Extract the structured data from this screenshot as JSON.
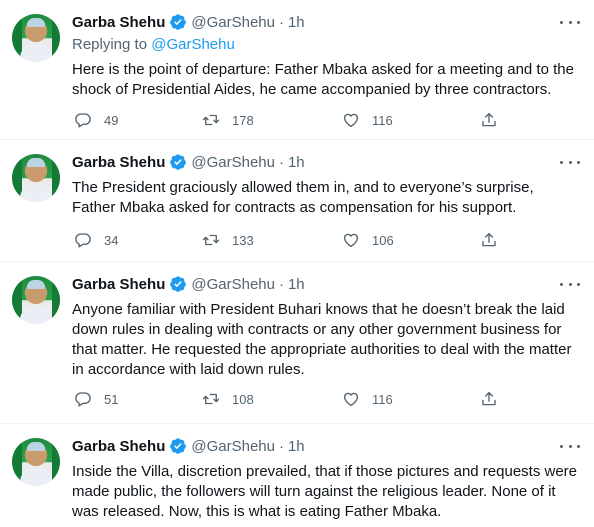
{
  "tweets": [
    {
      "author": "Garba Shehu",
      "handle": "@GarShehu",
      "separator": "·",
      "time": "1h",
      "replying_label": "Replying to",
      "replying_to": "@GarShehu",
      "text": "Here is the point of departure: Father Mbaka asked for a meeting and to the shock of Presidential Aides, he came accompanied by three contractors.",
      "replies": "49",
      "retweets": "178",
      "likes": "116"
    },
    {
      "author": "Garba Shehu",
      "handle": "@GarShehu",
      "separator": "·",
      "time": "1h",
      "text": "The President graciously allowed them in, and to everyone’s surprise, Father Mbaka asked for contracts as compensation for his support.",
      "replies": "34",
      "retweets": "133",
      "likes": "106"
    },
    {
      "author": "Garba Shehu",
      "handle": "@GarShehu",
      "separator": "·",
      "time": "1h",
      "text": "Anyone familiar with President Buhari knows that he doesn’t break the laid down rules in dealing with contracts or any other government business for that matter. He requested the appropriate authorities to deal with the matter in accordance with laid down rules.",
      "replies": "51",
      "retweets": "108",
      "likes": "116"
    },
    {
      "author": "Garba Shehu",
      "handle": "@GarShehu",
      "separator": "·",
      "time": "1h",
      "text": "Inside the Villa, discretion prevailed, that if those pictures and requests were made public, the followers will turn against the religious leader. None of it was released. Now, this is what is eating Father Mbaka."
    }
  ],
  "colors": {
    "accent": "#1d9bf0",
    "secondary_text": "#536471",
    "primary_text": "#0f1419"
  },
  "icons": [
    "verified-badge-icon",
    "more-icon",
    "reply-icon",
    "retweet-icon",
    "like-icon",
    "share-icon"
  ]
}
